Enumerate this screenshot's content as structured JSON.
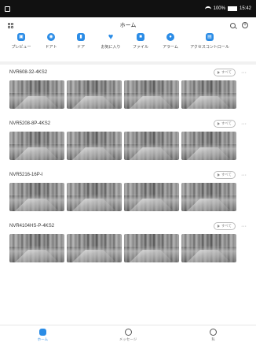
{
  "status_bar": {
    "battery": "100%",
    "time": "15:42"
  },
  "header": {
    "title": "ホーム"
  },
  "shortcuts": [
    {
      "label": "プレビュー",
      "icon": "preview-icon"
    },
    {
      "label": "ドアト",
      "icon": "doorbell-icon"
    },
    {
      "label": "ドア",
      "icon": "door-icon"
    },
    {
      "label": "お気に入り",
      "icon": "heart-icon"
    },
    {
      "label": "ファイル",
      "icon": "folder-icon"
    },
    {
      "label": "アラーム",
      "icon": "alarm-icon"
    },
    {
      "label": "アクセスコントロール",
      "icon": "access-control-icon"
    }
  ],
  "devices": [
    {
      "name": "NVR608-32-4KS2",
      "all_label": "すべて",
      "thumb_count": 4
    },
    {
      "name": "NVR5208-8P-4KS2",
      "all_label": "すべて",
      "thumb_count": 4
    },
    {
      "name": "NVR5216-16P-I",
      "all_label": "すべて",
      "thumb_count": 4
    },
    {
      "name": "NVR4104HS-P-4KS2",
      "all_label": "すべて",
      "thumb_count": 4
    }
  ],
  "tabs": [
    {
      "label": "ホーム",
      "active": true
    },
    {
      "label": "メッセージ",
      "active": false
    },
    {
      "label": "私",
      "active": false
    }
  ],
  "colors": {
    "accent": "#2b8ce6"
  }
}
